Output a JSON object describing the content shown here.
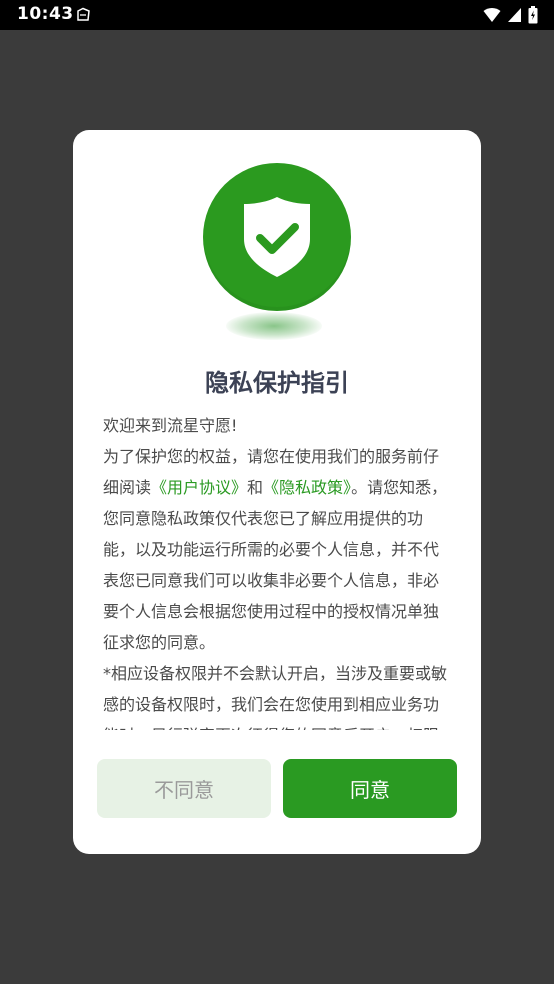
{
  "status_bar": {
    "time": "10:43",
    "icons": [
      "app-notification-icon",
      "wifi-icon",
      "signal-icon",
      "battery-icon"
    ]
  },
  "dialog": {
    "badge_icon": "shield-check-icon",
    "title": "隐私保护指引",
    "intro": "欢迎来到流星守愿!",
    "paragraph1_before": "为了保护您的权益，请您在使用我们的服务前仔细阅读",
    "link_user_agreement": "《用户协议》",
    "and_text": "和",
    "link_privacy_policy": "《隐私政策》",
    "paragraph1_after": "。请您知悉，您同意隐私政策仅代表您已了解应用提供的功能，以及功能运行所需的必要个人信息，并不代表您已同意我们可以收集非必要个人信息，非必要个人信息会根据您使用过程中的授权情况单独征求您的同意。",
    "paragraph2": "*相应设备权限并不会默认开启，当涉及重要或敏感的设备权限时，我们会在您使用到相应业务功能时，另行弹窗再次征得您的同意后开启；权限",
    "disagree_label": "不同意",
    "agree_label": "同意"
  },
  "colors": {
    "accent": "#2a9a22",
    "disagree_bg": "#e7f2e5",
    "backdrop": "#3b3b3b"
  }
}
